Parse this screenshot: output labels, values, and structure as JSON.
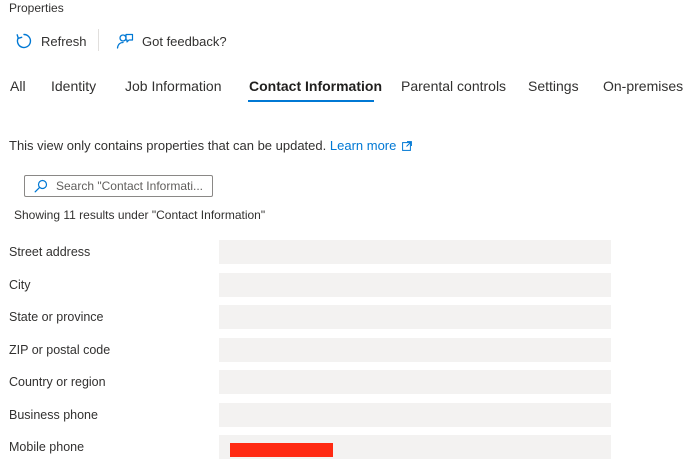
{
  "header": {
    "title": "Properties"
  },
  "toolbar": {
    "refresh_label": "Refresh",
    "feedback_label": "Got feedback?"
  },
  "tabs": [
    {
      "label": "All"
    },
    {
      "label": "Identity"
    },
    {
      "label": "Job Information"
    },
    {
      "label": "Contact Information",
      "active": true
    },
    {
      "label": "Parental controls"
    },
    {
      "label": "Settings"
    },
    {
      "label": "On-premises"
    }
  ],
  "notice": {
    "text": "This view only contains properties that can be updated.",
    "link_label": "Learn more"
  },
  "search": {
    "placeholder": "Search \"Contact Informati..."
  },
  "results": {
    "text": "Showing 11 results under \"Contact Information\""
  },
  "properties": [
    {
      "label": "Street address",
      "value": ""
    },
    {
      "label": "City",
      "value": ""
    },
    {
      "label": "State or province",
      "value": ""
    },
    {
      "label": "ZIP or postal code",
      "value": ""
    },
    {
      "label": "Country or region",
      "value": ""
    },
    {
      "label": "Business phone",
      "value": ""
    },
    {
      "label": "Mobile phone",
      "value": ""
    }
  ],
  "colors": {
    "accent": "#0078d4",
    "field_bg": "#f3f2f1",
    "redaction": "#ff2a12"
  },
  "icons": {
    "refresh": "refresh-icon",
    "feedback": "feedback-icon",
    "external_link": "external-link-icon",
    "search": "search-icon"
  }
}
